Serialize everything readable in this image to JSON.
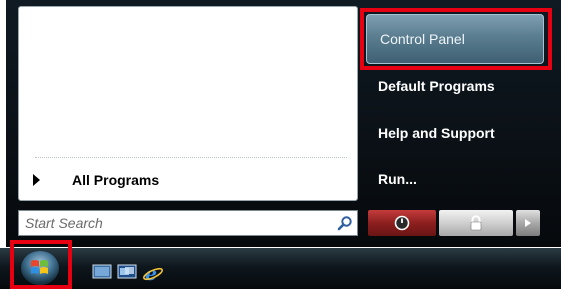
{
  "start_menu": {
    "all_programs_label": "All Programs",
    "search": {
      "placeholder": "Start Search"
    },
    "right_items": {
      "control_panel": "Control Panel",
      "default_programs": "Default Programs",
      "help_and_support": "Help and Support",
      "run": "Run..."
    },
    "power_buttons": [
      "power-icon",
      "lock-icon",
      "arrow-right-icon"
    ]
  },
  "taskbar": {
    "quick_launch_icons": [
      "show-desktop-icon",
      "switch-windows-icon",
      "internet-explorer-icon"
    ]
  },
  "colors": {
    "highlight": "#e60012",
    "menu_bg": "#0b1117",
    "control_panel_selected": "#5b7d90"
  }
}
